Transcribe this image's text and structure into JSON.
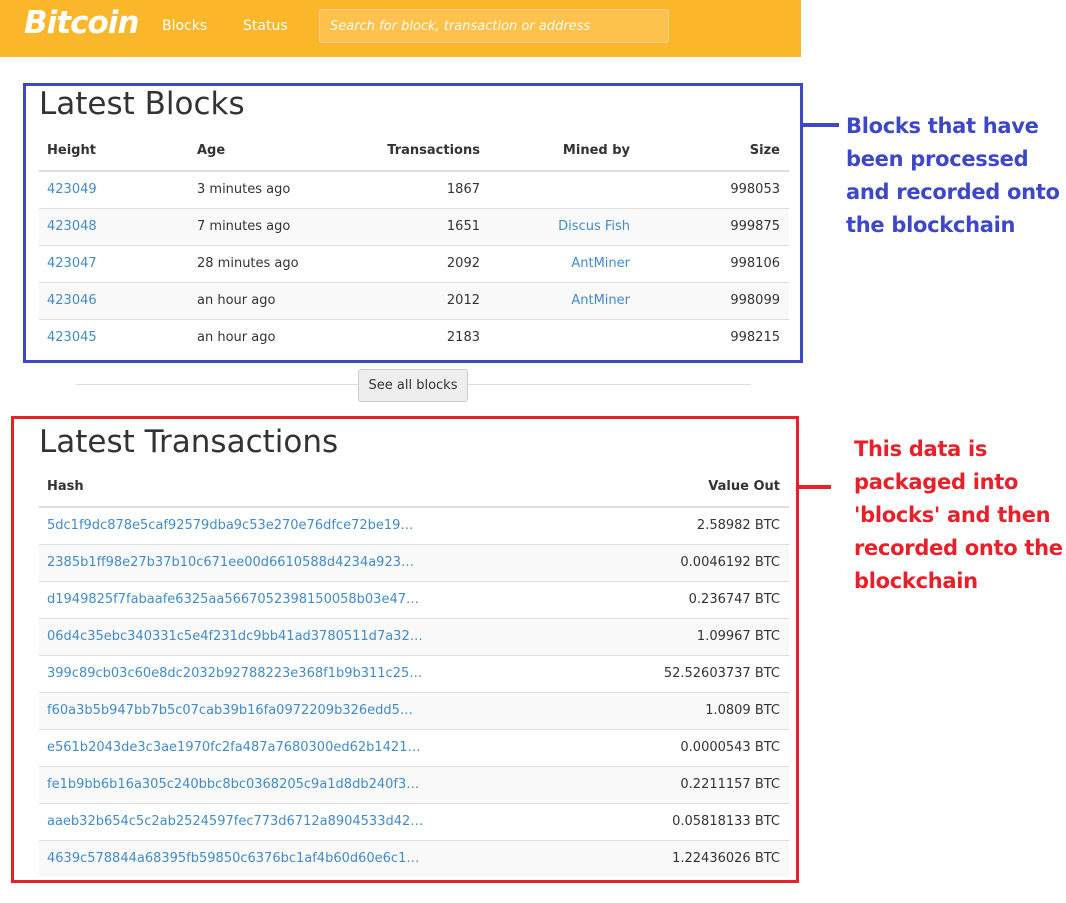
{
  "navbar": {
    "brand": "Bitcoin",
    "links": [
      "Blocks",
      "Status"
    ],
    "search_placeholder": "Search for block, transaction or address"
  },
  "blocks": {
    "title": "Latest Blocks",
    "columns": [
      "Height",
      "Age",
      "Transactions",
      "Mined by",
      "Size"
    ],
    "rows": [
      {
        "height": "423049",
        "age": "3 minutes ago",
        "transactions": "1867",
        "mined_by": "",
        "size": "998053"
      },
      {
        "height": "423048",
        "age": "7 minutes ago",
        "transactions": "1651",
        "mined_by": "Discus Fish",
        "size": "999875"
      },
      {
        "height": "423047",
        "age": "28 minutes ago",
        "transactions": "2092",
        "mined_by": "AntMiner",
        "size": "998106"
      },
      {
        "height": "423046",
        "age": "an hour ago",
        "transactions": "2012",
        "mined_by": "AntMiner",
        "size": "998099"
      },
      {
        "height": "423045",
        "age": "an hour ago",
        "transactions": "2183",
        "mined_by": "",
        "size": "998215"
      }
    ],
    "see_all_label": "See all blocks"
  },
  "transactions": {
    "title": "Latest Transactions",
    "columns": [
      "Hash",
      "Value Out"
    ],
    "rows": [
      {
        "hash": "5dc1f9dc878e5caf92579dba9c53e270e76dfce72be19…",
        "value": "2.58982 BTC"
      },
      {
        "hash": "2385b1ff98e27b37b10c671ee00d6610588d4234a923…",
        "value": "0.0046192 BTC"
      },
      {
        "hash": "d1949825f7fabaafe6325aa5667052398150058b03e47…",
        "value": "0.236747 BTC"
      },
      {
        "hash": "06d4c35ebc340331c5e4f231dc9bb41ad3780511d7a32…",
        "value": "1.09967 BTC"
      },
      {
        "hash": "399c89cb03c60e8dc2032b92788223e368f1b9b311c25…",
        "value": "52.52603737 BTC"
      },
      {
        "hash": "f60a3b5b947bb7b5c07cab39b16fa0972209b326edd5…",
        "value": "1.0809 BTC"
      },
      {
        "hash": "e561b2043de3c3ae1970fc2fa487a7680300ed62b1421…",
        "value": "0.0000543 BTC"
      },
      {
        "hash": "fe1b9bb6b16a305c240bbc8bc0368205c9a1d8db240f3…",
        "value": "0.2211157 BTC"
      },
      {
        "hash": "aaeb32b654c5c2ab2524597fec773d6712a8904533d42…",
        "value": "0.05818133 BTC"
      },
      {
        "hash": "4639c578844a68395fb59850c6376bc1af4b60d60e6c1…",
        "value": "1.22436026 BTC"
      }
    ]
  },
  "annotations": {
    "blocks_note": [
      "Blocks that have",
      "been processed",
      "and recorded onto",
      "the blockchain"
    ],
    "transactions_note": [
      "This data is",
      "packaged into",
      "'blocks' and then",
      "recorded onto the",
      "blockchain"
    ]
  },
  "colors": {
    "navbar": "#fbb729",
    "link": "#428bca",
    "annotation_blue": "#3d47c9",
    "annotation_red": "#e8202a"
  }
}
